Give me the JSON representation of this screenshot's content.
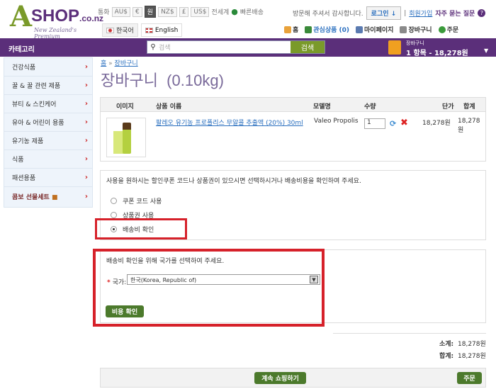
{
  "logo": {
    "a": "A",
    "shop": "SHOP",
    "tld": ".co.nz",
    "tagline": "New Zealand's Premium"
  },
  "currency": {
    "label": "통화",
    "items": [
      "AU$",
      "€",
      "원",
      "NZ$",
      "£",
      "US$"
    ],
    "active": "원",
    "worldwide": "전세계",
    "worldwide_ship": "빠른배송"
  },
  "languages": [
    {
      "label": "한국어",
      "flag": "kr"
    },
    {
      "label": "English",
      "flag": "uk"
    }
  ],
  "header": {
    "greeting": "방문해 주셔서 감사합니다.",
    "login": "로그인",
    "register": "회원가입",
    "faq": "자주 묻는 질문"
  },
  "nav": {
    "home": "홈",
    "wishlist": "관심상품 (0)",
    "mypage": "마이페이지",
    "cart": "장바구니",
    "checkout": "주문"
  },
  "topbar": {
    "category": "카테고리",
    "search_placeholder": "검색",
    "search_button": "검색",
    "cart_title": "장바구니",
    "cart_summary": "1 항목 - 18,278원"
  },
  "sidebar": {
    "items": [
      "건강식품",
      "꿀 & 꿀 관련 제품",
      "뷰티 & 스킨케어",
      "유아 & 어린이 용품",
      "유기농 제품",
      "식품",
      "패션용품",
      "콤보 선물세트"
    ]
  },
  "breadcrumb": {
    "home": "홈",
    "sep": "»",
    "current": "장바구니"
  },
  "page_title": "장바구니  (0.10kg)",
  "table": {
    "headers": {
      "image": "이미지",
      "name": "상품 이름",
      "model": "모델명",
      "qty": "수량",
      "unit": "단가",
      "total": "합계"
    },
    "rows": [
      {
        "name": "팔레오 유기농 프로폴리스 무알콜 추출액 (20%) 30ml",
        "model": "Valeo Propolis",
        "qty": "1",
        "unit": "18,278원",
        "total": "18,278원"
      }
    ]
  },
  "options": {
    "text": "사용을 원하시는 할인쿠폰 코드나 상품권이 있으시면 선택하시거나 배송비용을 확인하여 주세요.",
    "radios": [
      {
        "label": "쿠폰 코드 사용",
        "checked": false
      },
      {
        "label": "상품권 사용",
        "checked": false
      },
      {
        "label": "배송비 확인",
        "checked": true
      }
    ]
  },
  "shipping": {
    "text": "배송비 확인을 위해 국가를 선택하여 주세요.",
    "country_label": "국가:",
    "country_value": "한국(Korea, Republic of)",
    "button": "비용 확인"
  },
  "totals": {
    "subtotal_label": "소계:",
    "subtotal": "18,278원",
    "total_label": "합계:",
    "total": "18,278원"
  },
  "footer": {
    "continue": "계속 쇼핑하기",
    "checkout": "주문"
  },
  "colors": {
    "brand": "#5b2f7a",
    "green": "#4c7a2c",
    "highlight": "#d6212a"
  }
}
